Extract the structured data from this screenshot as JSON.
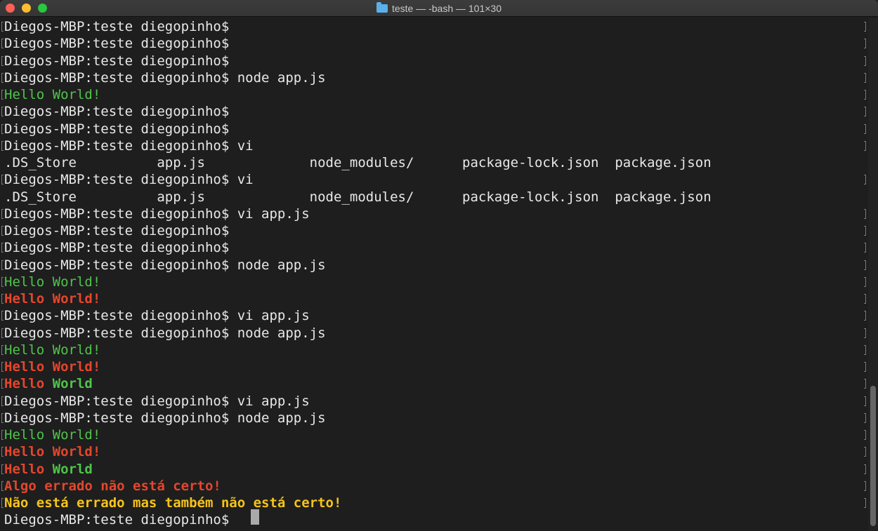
{
  "window": {
    "title": "teste — -bash — 101×30",
    "folder_icon": "folder-icon"
  },
  "colors": {
    "background": "#1e1e1e",
    "text": "#e8e8e8",
    "green": "#4fc44a",
    "red": "#e5462c",
    "yellow": "#f7c419"
  },
  "terminal": {
    "lines": [
      [
        {
          "t": "Diegos-MBP:teste diegopinho$",
          "c": "white"
        }
      ],
      [
        {
          "t": "Diegos-MBP:teste diegopinho$",
          "c": "white"
        }
      ],
      [
        {
          "t": "Diegos-MBP:teste diegopinho$",
          "c": "white"
        }
      ],
      [
        {
          "t": "Diegos-MBP:teste diegopinho$ node app.js",
          "c": "white"
        }
      ],
      [
        {
          "t": "Hello World!",
          "c": "green"
        }
      ],
      [
        {
          "t": "Diegos-MBP:teste diegopinho$",
          "c": "white"
        }
      ],
      [
        {
          "t": "Diegos-MBP:teste diegopinho$",
          "c": "white"
        }
      ],
      [
        {
          "t": "Diegos-MBP:teste diegopinho$ vi",
          "c": "white"
        }
      ],
      [
        {
          "t": ".DS_Store          app.js             node_modules/      package-lock.json  package.json",
          "c": "white"
        }
      ],
      [
        {
          "t": "Diegos-MBP:teste diegopinho$ vi",
          "c": "white"
        }
      ],
      [
        {
          "t": ".DS_Store          app.js             node_modules/      package-lock.json  package.json",
          "c": "white"
        }
      ],
      [
        {
          "t": "Diegos-MBP:teste diegopinho$ vi app.js",
          "c": "white"
        }
      ],
      [
        {
          "t": "Diegos-MBP:teste diegopinho$",
          "c": "white"
        }
      ],
      [
        {
          "t": "Diegos-MBP:teste diegopinho$",
          "c": "white"
        }
      ],
      [
        {
          "t": "Diegos-MBP:teste diegopinho$ node app.js",
          "c": "white"
        }
      ],
      [
        {
          "t": "Hello World!",
          "c": "green"
        }
      ],
      [
        {
          "t": "Hello World!",
          "c": "red"
        }
      ],
      [
        {
          "t": "Diegos-MBP:teste diegopinho$ vi app.js",
          "c": "white"
        }
      ],
      [
        {
          "t": "Diegos-MBP:teste diegopinho$ node app.js",
          "c": "white"
        }
      ],
      [
        {
          "t": "Hello World!",
          "c": "green"
        }
      ],
      [
        {
          "t": "Hello World!",
          "c": "red"
        }
      ],
      [
        {
          "t": "Hello ",
          "c": "red"
        },
        {
          "t": "World",
          "c": "greenb"
        }
      ],
      [
        {
          "t": "Diegos-MBP:teste diegopinho$ vi app.js",
          "c": "white"
        }
      ],
      [
        {
          "t": "Diegos-MBP:teste diegopinho$ node app.js",
          "c": "white"
        }
      ],
      [
        {
          "t": "Hello World!",
          "c": "green"
        }
      ],
      [
        {
          "t": "Hello World!",
          "c": "red"
        }
      ],
      [
        {
          "t": "Hello ",
          "c": "red"
        },
        {
          "t": "World",
          "c": "greenb"
        }
      ],
      [
        {
          "t": "Algo errado não está certo!",
          "c": "red"
        }
      ],
      [
        {
          "t": "Não está errado mas também não está certo!",
          "c": "yellow"
        }
      ],
      [
        {
          "t": "Diegos-MBP:teste diegopinho$ ",
          "c": "white"
        }
      ]
    ]
  }
}
